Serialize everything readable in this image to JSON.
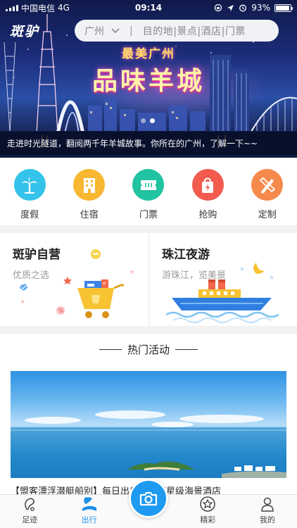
{
  "status_bar": {
    "carrier": "中国电信",
    "network": "4G",
    "time": "09:14",
    "battery": "93%",
    "battery_level": 0.93
  },
  "header": {
    "logo": "斑驴",
    "city": "广州",
    "search_placeholder": "目的地|景点|酒店|门票"
  },
  "banner": {
    "slogan_top": "最美广州",
    "slogan_main": "品味羊城",
    "caption": "走进时光隧道，翻阅两千年羊城故事。你所在的广州，了解一下~~",
    "slide_count": 2,
    "active_slide": 2
  },
  "categories": [
    {
      "label": "度假",
      "icon": "palm-tree-icon",
      "color": "#34c3ea"
    },
    {
      "label": "住宿",
      "icon": "building-icon",
      "color": "#f7b731"
    },
    {
      "label": "门票",
      "icon": "ticket-icon",
      "color": "#22c3a0"
    },
    {
      "label": "抢购",
      "icon": "shopping-bag-icon",
      "color": "#f25b4e"
    },
    {
      "label": "定制",
      "icon": "pencil-ruler-icon",
      "color": "#f6894c"
    }
  ],
  "features": [
    {
      "title": "斑驴自营",
      "subtitle": "优质之选"
    },
    {
      "title": "珠江夜游",
      "subtitle": "游珠江，览美景"
    }
  ],
  "activities": {
    "heading": "热门活动",
    "item_title": "【盟客漂浮潜艇船别】每日出发：选四星级海景酒店"
  },
  "tabbar": {
    "tabs": [
      {
        "label": "足迹",
        "icon": "footprint-icon"
      },
      {
        "label": "出行",
        "icon": "travel-icon",
        "active": true
      },
      {
        "label": "精彩",
        "icon": "star-icon"
      },
      {
        "label": "我的",
        "icon": "user-icon"
      }
    ],
    "center_icon": "camera-icon"
  },
  "colors": {
    "accent": "#1e8ee6",
    "camera_button": "#1e9af0"
  }
}
